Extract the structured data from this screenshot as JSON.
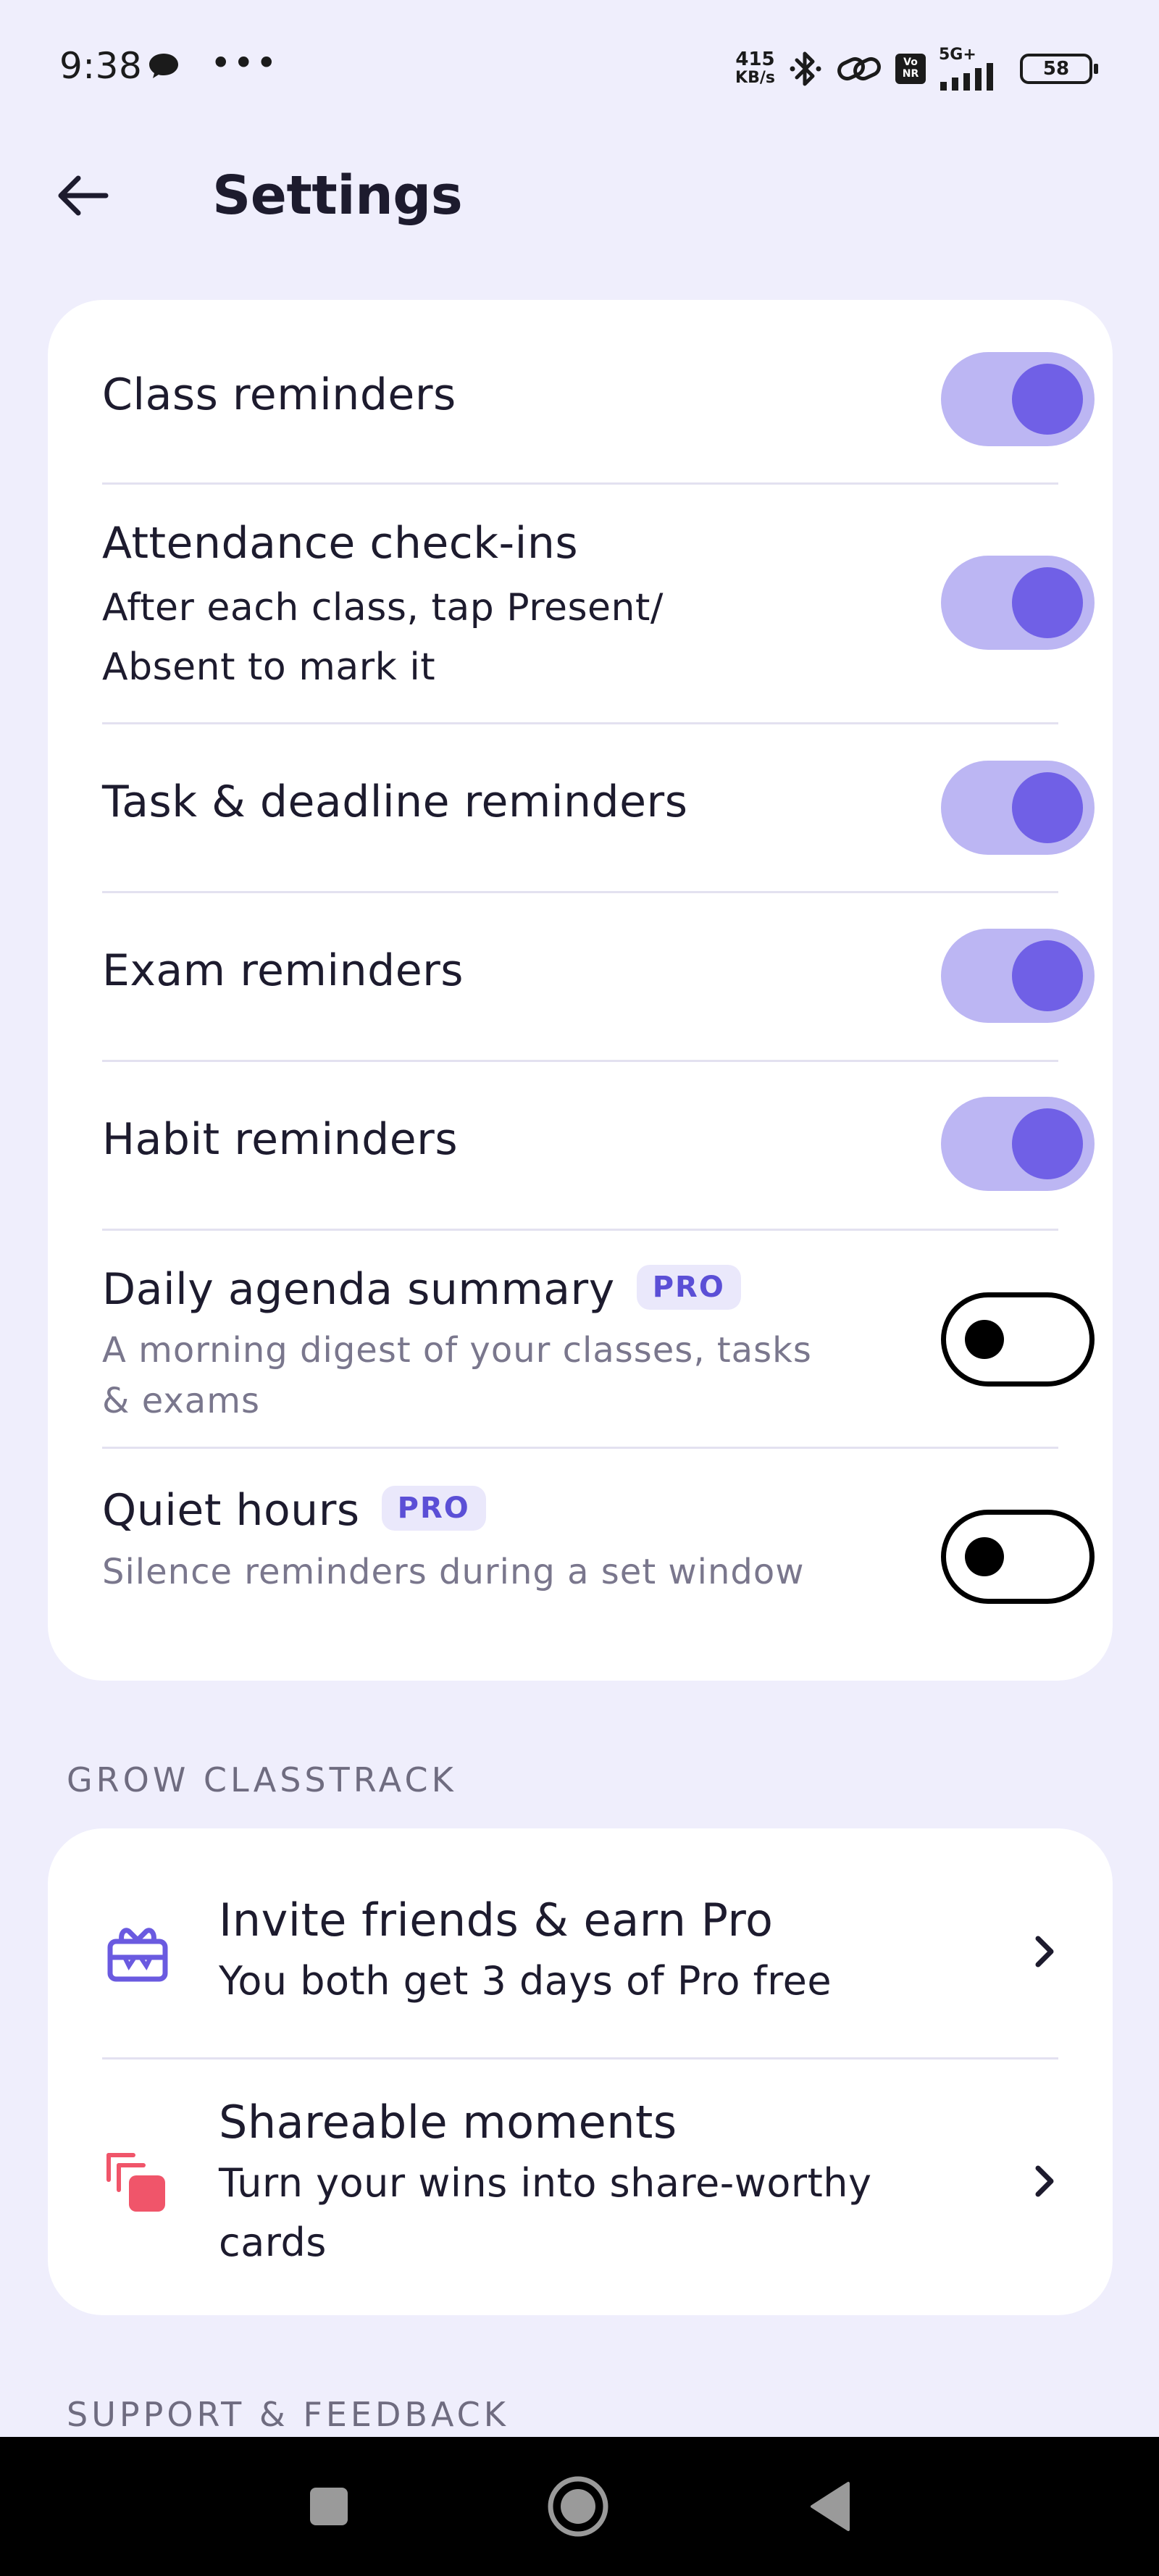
{
  "status_bar": {
    "time": "9:38",
    "dots": "•••",
    "net_speed_value": "415",
    "net_speed_unit": "KB/s",
    "volte_label": "Vo\nNR",
    "network_type": "5G+",
    "battery": "58",
    "icons": [
      "chat-bubble-icon",
      "bluetooth-icon",
      "link-icon",
      "volte-icon",
      "signal-icon",
      "battery-icon"
    ]
  },
  "header": {
    "title": "Settings",
    "back_icon": "arrow-left-icon"
  },
  "notifications": {
    "items": [
      {
        "title": "Class reminders",
        "enabled": true
      },
      {
        "title": "Attendance check-ins",
        "subtitle_line1": "After each class, tap Present/",
        "subtitle_line2": "Absent to mark it",
        "enabled": true
      },
      {
        "title": "Task & deadline reminders",
        "enabled": true
      },
      {
        "title": "Exam reminders",
        "enabled": true
      },
      {
        "title": "Habit reminders",
        "enabled": true
      },
      {
        "title": "Daily agenda summary",
        "badge": "PRO",
        "subtitle_line1": "A morning digest of your classes, tasks",
        "subtitle_line2": "& exams",
        "enabled": false
      },
      {
        "title": "Quiet hours",
        "badge": "PRO",
        "subtitle_line1": "Silence reminders during a set window",
        "enabled": false
      }
    ]
  },
  "grow": {
    "section_label": "GROW CLASSTRACK",
    "items": [
      {
        "icon": "gift-box-icon",
        "title": "Invite friends & earn Pro",
        "subtitle_line1": "You both get 3 days of Pro free"
      },
      {
        "icon": "stacked-cards-icon",
        "title": "Shareable moments",
        "subtitle_line1": "Turn your wins into share-worthy",
        "subtitle_line2": "cards"
      }
    ]
  },
  "support": {
    "section_label": "SUPPORT & FEEDBACK"
  },
  "colors": {
    "background": "#efeefc",
    "card": "#ffffff",
    "accent": "#7060e6",
    "toggle_track_on": "#bcb6f3",
    "pro_badge_bg": "#eae8fb",
    "pro_badge_text": "#5b4fd6",
    "invite_icon": "#6a5ae0",
    "share_icon": "#f0556a"
  },
  "nav_bar": {
    "buttons": [
      "recent-apps-icon",
      "home-icon",
      "back-triangle-icon"
    ]
  }
}
